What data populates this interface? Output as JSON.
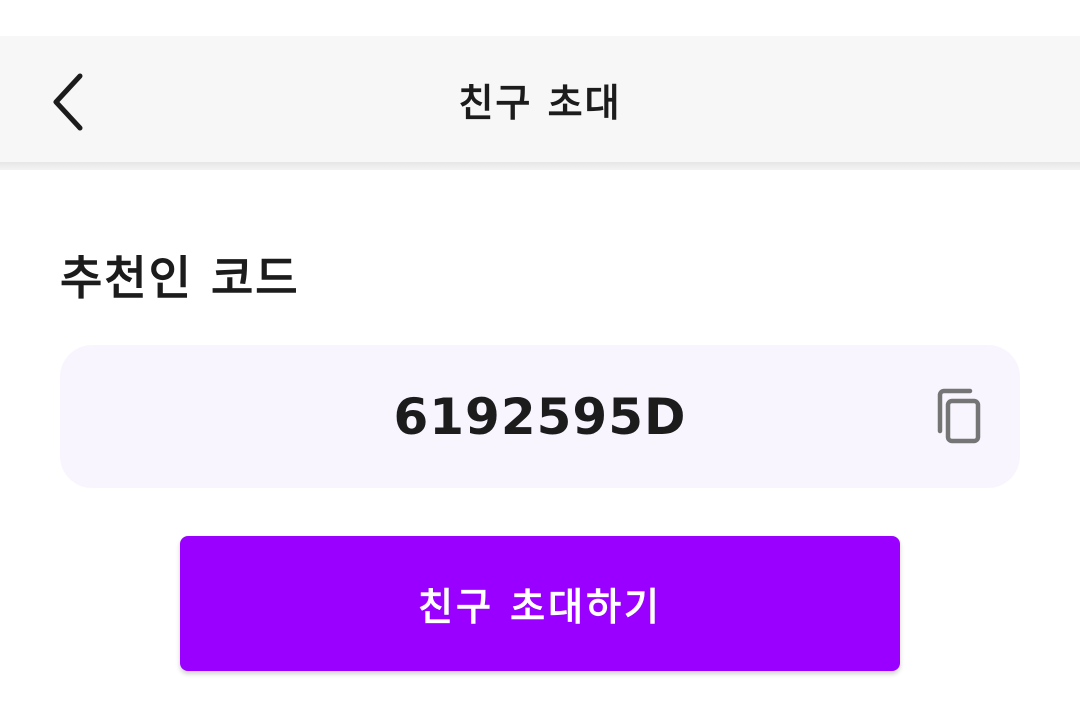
{
  "header": {
    "title": "친구 초대",
    "back_icon": "chevron-left-icon"
  },
  "referral": {
    "label": "추천인 코드",
    "code": "6192595D",
    "copy_icon": "copy-icon"
  },
  "actions": {
    "invite_label": "친구 초대하기"
  },
  "colors": {
    "accent": "#9900ff",
    "code_box_bg": "#f8f5ff",
    "app_bar_bg": "#f7f7f7",
    "text": "#1c1c1c",
    "icon_gray": "#757575"
  }
}
